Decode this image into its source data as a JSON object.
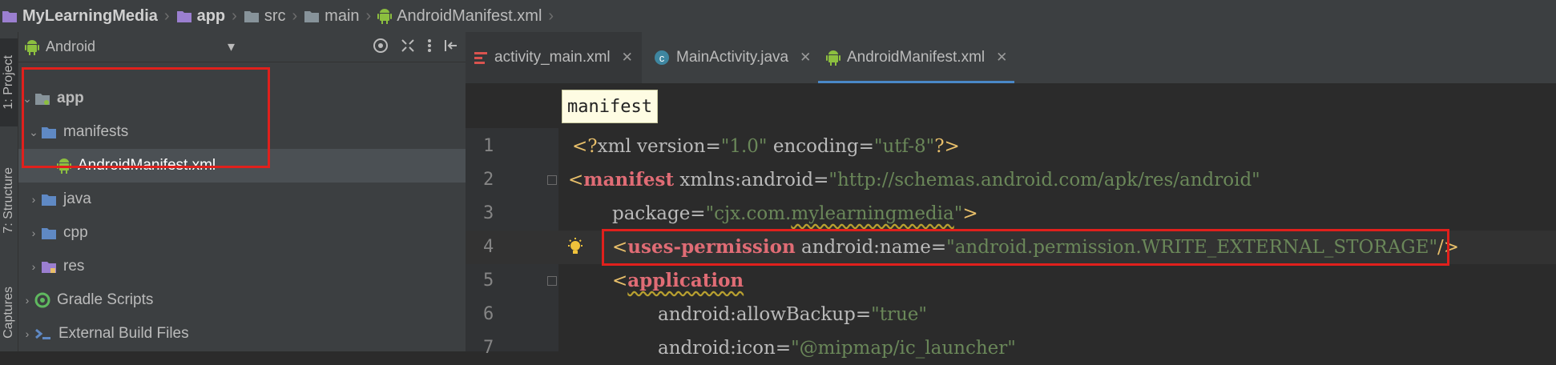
{
  "breadcrumb": {
    "items": [
      {
        "label": "MyLearningMedia",
        "icon": "module-icon"
      },
      {
        "label": "app",
        "icon": "folder-icon"
      },
      {
        "label": "src",
        "icon": "folder-icon"
      },
      {
        "label": "main",
        "icon": "folder-icon"
      },
      {
        "label": "AndroidManifest.xml",
        "icon": "android-icon"
      }
    ]
  },
  "tool_stripe": {
    "project": "1: Project",
    "structure": "7: Structure",
    "captures": "Captures"
  },
  "project_panel": {
    "view_selector": "Android",
    "tree": [
      {
        "label": "app",
        "icon": "module-folder-icon",
        "expanded": true
      },
      {
        "label": "manifests",
        "icon": "folder-icon",
        "expanded": true
      },
      {
        "label": "AndroidManifest.xml",
        "icon": "android-icon",
        "selected": true
      },
      {
        "label": "java",
        "icon": "folder-icon",
        "expanded": false
      },
      {
        "label": "cpp",
        "icon": "folder-icon",
        "expanded": false
      },
      {
        "label": "res",
        "icon": "res-folder-icon",
        "expanded": false
      },
      {
        "label": "Gradle Scripts",
        "icon": "gradle-icon",
        "expanded": false
      },
      {
        "label": "External Build Files",
        "icon": "cmake-icon",
        "expanded": false
      }
    ]
  },
  "editor": {
    "tabs": [
      {
        "label": "activity_main.xml",
        "icon": "layout-icon"
      },
      {
        "label": "MainActivity.java",
        "icon": "class-icon"
      },
      {
        "label": "AndroidManifest.xml",
        "icon": "android-icon",
        "active": true
      }
    ],
    "tooltip": "manifest",
    "line_numbers": [
      "1",
      "2",
      "3",
      "4",
      "5",
      "6",
      "7"
    ],
    "lines": {
      "l1": {
        "open": "<?",
        "xml": "xml",
        "v_attr": " version=",
        "v_val": "\"1.0\"",
        "e_attr": " encoding=",
        "e_val": "\"utf-8\"",
        "close": "?>"
      },
      "l2": {
        "open": "<",
        "name": "manifest",
        "attr": " xmlns:android=",
        "val": "\"http://schemas.android.com/apk/res/android\""
      },
      "l3": {
        "attr": "package=",
        "val_q1": "\"",
        "val_a": "cjx.com.",
        "val_b": "mylearningmedia",
        "val_q2": "\"",
        "close": ">"
      },
      "l4": {
        "open": "<",
        "name": "uses-permission",
        "attr": " android:name=",
        "val": "\"android.permission.WRITE_EXTERNAL_STORAGE\"",
        "close": "/>"
      },
      "l5": {
        "open": "<",
        "name": "application"
      },
      "l6": {
        "attr": "android:allowBackup=",
        "val": "\"true\""
      },
      "l7": {
        "attr": "android:icon=",
        "val": "\"@mipmap/ic_launcher\""
      }
    }
  },
  "colors": {
    "highlight_box": "#e0201c",
    "active_tab_underline": "#4a88c7",
    "string": "#6a8759",
    "tag_name": "#e06c75"
  }
}
